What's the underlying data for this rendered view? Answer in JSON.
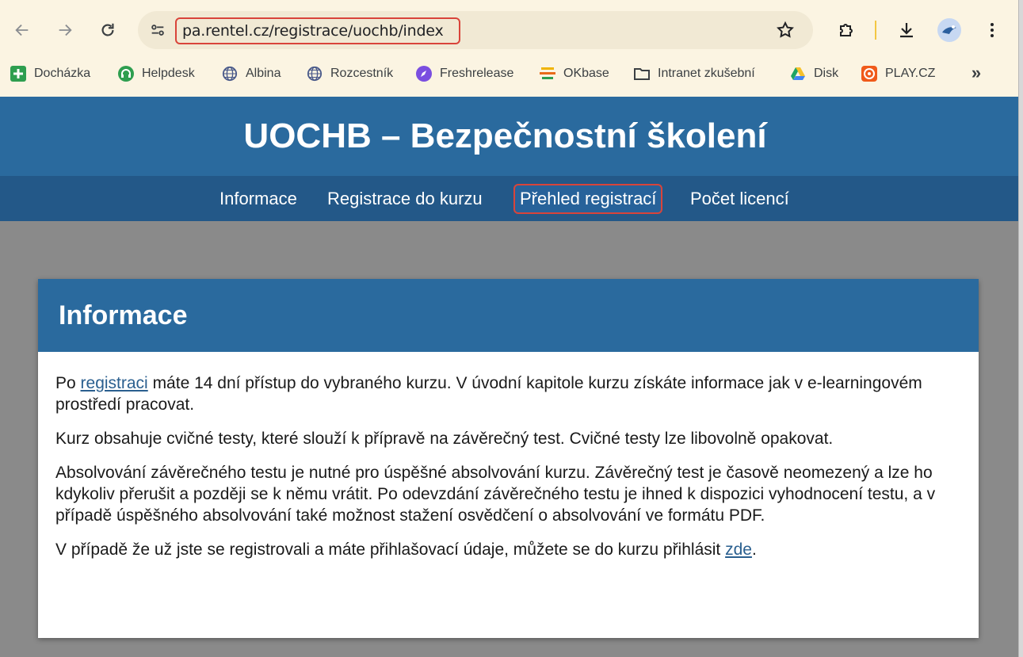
{
  "browser": {
    "url": "pa.rentel.cz/registrace/uochb/index",
    "bookmarks": [
      {
        "label": "Docházka",
        "icon": "plus-green-icon"
      },
      {
        "label": "Helpdesk",
        "icon": "headset-icon"
      },
      {
        "label": "Albina",
        "icon": "globe-icon"
      },
      {
        "label": "Rozcestník",
        "icon": "globe-icon"
      },
      {
        "label": "Freshrelease",
        "icon": "rocket-icon"
      },
      {
        "label": "OKbase",
        "icon": "okbase-icon"
      },
      {
        "label": "Intranet zkušební",
        "icon": "folder-icon"
      },
      {
        "label": "Disk",
        "icon": "drive-icon"
      },
      {
        "label": "PLAY.CZ",
        "icon": "play-icon"
      }
    ],
    "more_bookmarks": "»"
  },
  "site": {
    "title": "UOCHB – Bezpečnostní školení",
    "nav": [
      "Informace",
      "Registrace do kurzu",
      "Přehled registrací",
      "Počet licencí"
    ],
    "highlighted_nav": "Přehled registrací"
  },
  "card": {
    "title": "Informace",
    "p1_before": "Po ",
    "p1_link": "registraci",
    "p1_after": " máte 14 dní přístup do vybraného kurzu. V úvodní kapitole kurzu získáte informace jak v e-learningovém prostředí pracovat.",
    "p2": "Kurz obsahuje cvičné testy, které slouží k přípravě na závěrečný test. Cvičné testy lze libovolně opakovat.",
    "p3": "Absolvování závěrečného testu je nutné pro úspěšné absolvování kurzu. Závěrečný test je časově neomezený a lze ho kdykoliv přerušit a později se k němu vrátit. Po odevzdání závěrečného testu je ihned k dispozici vyhodnocení testu, a v případě úspěšného absolvování také možnost stažení osvědčení o absolvování ve formátu PDF.",
    "p4_before": "V případě že už jste se registrovali a máte přihlašovací údaje, můžete se do kurzu přihlásit ",
    "p4_link": "zde",
    "p4_after": "."
  },
  "colors": {
    "header_bg": "#2a6a9e",
    "nav_bg": "#235888",
    "page_bg": "#8a8a8a",
    "highlight": "#d9443a"
  }
}
